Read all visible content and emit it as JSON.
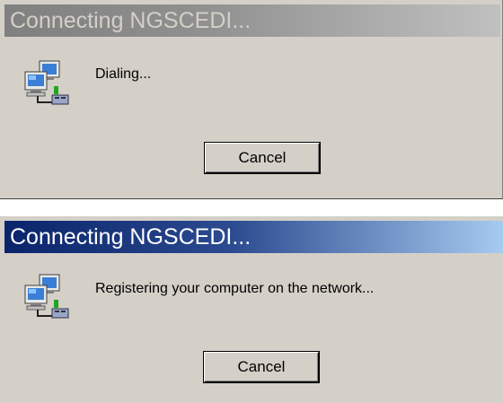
{
  "dialogs": [
    {
      "title": "Connecting NGSCEDI...",
      "state": "inactive",
      "message": "Dialing...",
      "icon": "network-connection-icon",
      "cancel_label": "Cancel"
    },
    {
      "title": "Connecting NGSCEDI...",
      "state": "active",
      "message": "Registering your computer on the network...",
      "icon": "network-connection-icon",
      "cancel_label": "Cancel"
    }
  ],
  "colors": {
    "dialog_face": "#d4d0c8",
    "active_title_start": "#0a246a",
    "active_title_end": "#a6caf0",
    "inactive_title_start": "#808080",
    "inactive_title_end": "#c0c0c0"
  }
}
